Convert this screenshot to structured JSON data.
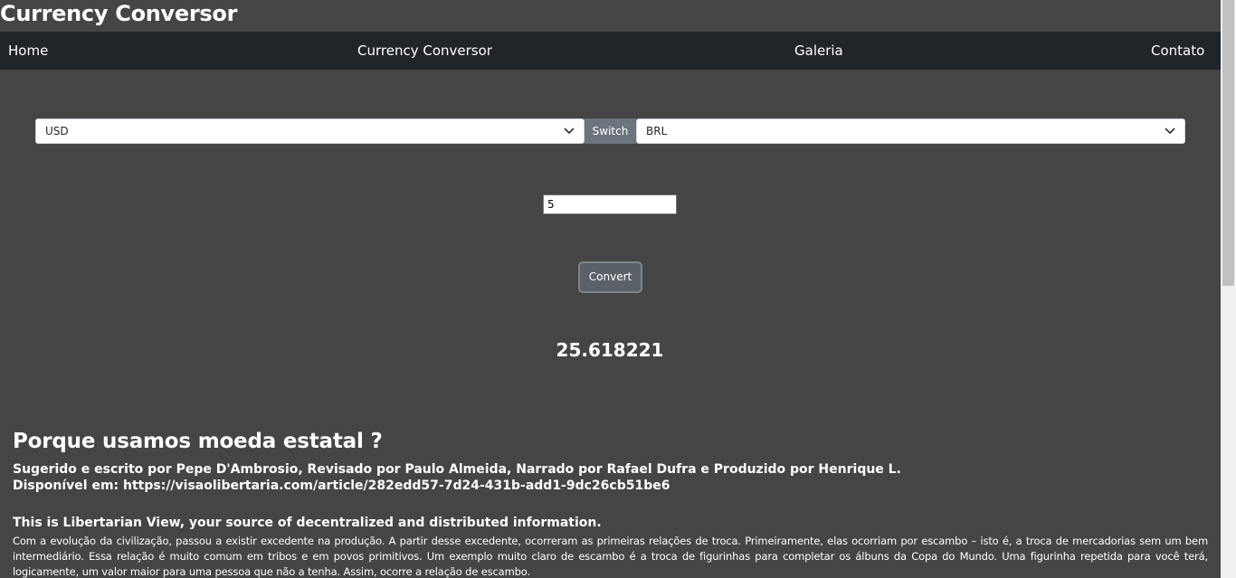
{
  "site_title": "Currency Conversor",
  "nav": {
    "home": "Home",
    "converter": "Currency Conversor",
    "gallery": "Galeria",
    "contact": "Contato"
  },
  "converter": {
    "from_currency": "USD",
    "switch_label": "Switch",
    "to_currency": "BRL",
    "amount": "5",
    "convert_label": "Convert",
    "result": "25.618221"
  },
  "article": {
    "heading": "Porque usamos moeda estatal ?",
    "byline": "Sugerido e escrito por Pepe D'Ambrosio, Revisado por Paulo Almeida, Narrado por Rafael Dufra e Produzido por Henrique L.",
    "source": "Disponível em: https://visaolibertaria.com/article/282edd57-7d24-431b-add1-9dc26cb51be6",
    "tagline": "This is Libertarian View, your source of decentralized and distributed information.",
    "body": "Com a evolução da civilização, passou a existir excedente na produção. A partir desse excedente, ocorreram as primeiras relações de troca. Primeiramente, elas ocorriam por escambo – isto é, a troca de mercadorias sem um bem intermediário. Essa relação é muito comum em tribos e em povos primitivos. Um exemplo muito claro de escambo é a troca de figurinhas para completar os álbuns da Copa do Mundo. Uma figurinha repetida para você terá, logicamente, um valor maior para uma pessoa que não a tenha. Assim, ocorre a relação de escambo."
  },
  "colors": {
    "background": "#454545",
    "navbar": "#212529",
    "switch_button": "#6c757d",
    "convert_button": "#5a6169"
  }
}
